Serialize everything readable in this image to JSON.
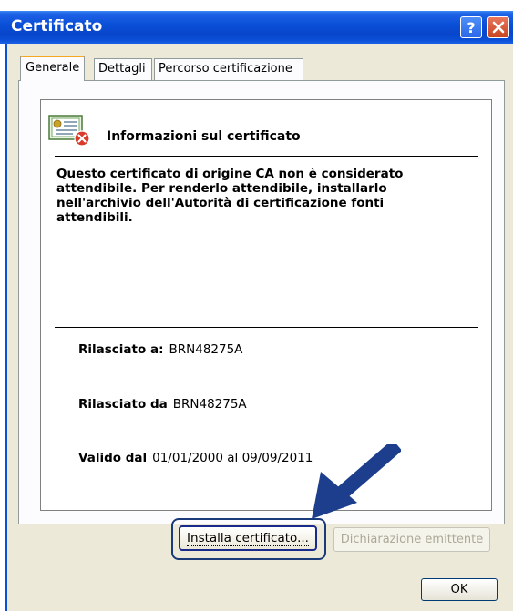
{
  "window": {
    "title": "Certificato",
    "help_icon": "question-mark-icon",
    "close_icon": "close-icon",
    "colors": {
      "titlebar": "#0a50d8",
      "close": "#c8431f",
      "body": "#ece9d8",
      "tab_accent": "#f5a623",
      "arrow": "#1c3e8c"
    }
  },
  "tabs": [
    {
      "label": "Generale",
      "selected": true
    },
    {
      "label": "Dettagli",
      "selected": false
    },
    {
      "label": "Percorso certificazione",
      "selected": false
    }
  ],
  "certificate": {
    "icon": "certificate-error-icon",
    "heading": "Informazioni sul certificato",
    "warning": "Questo certificato di origine CA non è considerato attendibile. Per renderlo attendibile, installarlo nell'archivio dell'Autorità di certificazione fonti attendibili.",
    "issued_to_label": "Rilasciato a:",
    "issued_to_value": "BRN48275A",
    "issued_by_label": "Rilasciato da",
    "issued_by_value": "BRN48275A",
    "valid_label": "Valido dal",
    "valid_from": "01/01/2000",
    "valid_sep": "al",
    "valid_to": "09/09/2011"
  },
  "buttons": {
    "install": "Installa certificato...",
    "issuer_statement": "Dichiarazione emittente",
    "ok": "OK"
  },
  "annotation": {
    "arrow_icon": "pointer-arrow-icon"
  }
}
